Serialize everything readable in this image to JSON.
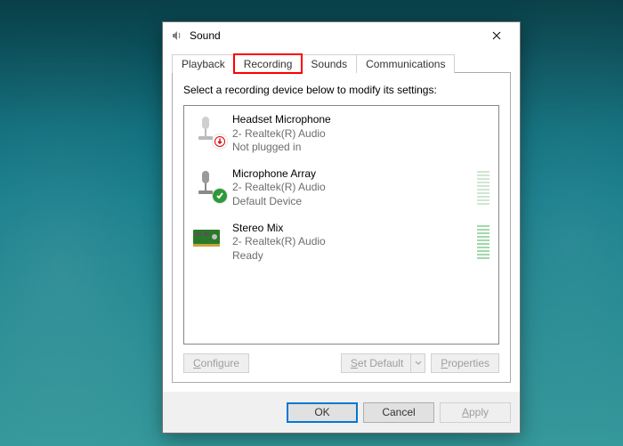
{
  "window": {
    "title": "Sound"
  },
  "tabs": [
    {
      "label": "Playback",
      "active": false
    },
    {
      "label": "Recording",
      "active": true,
      "highlighted": true
    },
    {
      "label": "Sounds",
      "active": false
    },
    {
      "label": "Communications",
      "active": false
    }
  ],
  "instruction": "Select a recording device below to modify its settings:",
  "devices": [
    {
      "name": "Headset Microphone",
      "sub": "2- Realtek(R) Audio",
      "status": "Not plugged in",
      "state": "unplugged"
    },
    {
      "name": "Microphone Array",
      "sub": "2- Realtek(R) Audio",
      "status": "Default Device",
      "state": "default"
    },
    {
      "name": "Stereo Mix",
      "sub": "2- Realtek(R) Audio",
      "status": "Ready",
      "state": "ready"
    }
  ],
  "panel_buttons": {
    "configure": "Configure",
    "set_default": "Set Default",
    "properties": "Properties"
  },
  "footer": {
    "ok": "OK",
    "cancel": "Cancel",
    "apply": "Apply"
  }
}
